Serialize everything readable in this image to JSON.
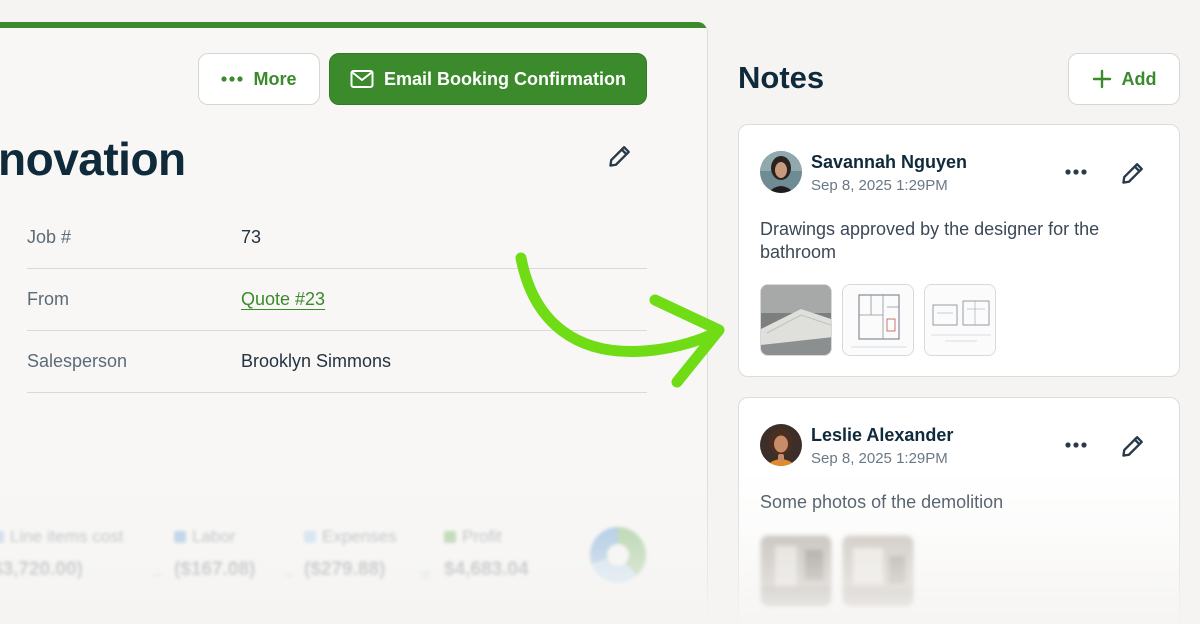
{
  "job": {
    "more_label": "More",
    "email_label": "Email Booking Confirmation",
    "title": "novation",
    "details": [
      {
        "label": "Job #",
        "value": "73"
      },
      {
        "label": "From",
        "value": "Quote #23"
      },
      {
        "label": "Salesperson",
        "value": "Brooklyn Simmons"
      }
    ],
    "costs": [
      {
        "label": "Line items cost",
        "value": "$3,720.00)"
      },
      {
        "label": "Labor",
        "value": "($167.08)"
      },
      {
        "label": "Expenses",
        "value": "($279.88)"
      },
      {
        "label": "Profit",
        "value": "$4,683.04"
      }
    ],
    "operators": [
      "−",
      "−",
      "="
    ],
    "colors": {
      "labor": "#5b9ad8",
      "expenses": "#9cc9ef",
      "profit": "#62a94e"
    }
  },
  "notes": {
    "title": "Notes",
    "add_label": "Add",
    "items": [
      {
        "author": "Savannah Nguyen",
        "date": "Sep 8, 2025 1:29PM",
        "text": "Drawings approved by the designer for the bathroom"
      },
      {
        "author": "Leslie Alexander",
        "date": "Sep 8, 2025 1:29PM",
        "text": "Some photos of the demolition"
      }
    ]
  },
  "colors": {
    "brand_green": "#3b8a2c",
    "arrow": "#6fdc16",
    "heading": "#0f2a3a"
  }
}
